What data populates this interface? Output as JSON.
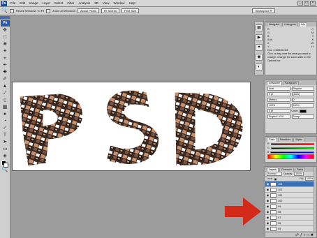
{
  "app": {
    "logo": "Ps"
  },
  "menu": [
    "File",
    "Edit",
    "Image",
    "Layer",
    "Select",
    "Filter",
    "Analysis",
    "3D",
    "View",
    "Window",
    "Help"
  ],
  "window_controls": [
    "_",
    "□",
    "×"
  ],
  "options": {
    "tool_icon": "zoom-icon",
    "resize_label": "Resize Windows To Fit",
    "zoom_all_label": "Zoom All Windows",
    "actual_pixels": "Actual Pixels",
    "fit_screen": "Fit Screen",
    "print_size": "Print Size",
    "workspace": "Workspace ▾"
  },
  "navigator": {
    "tabs": [
      "Navigator",
      "Histogram",
      "Info"
    ],
    "doc_info": "Doc: 4.30M/26.3M",
    "hint": "Click or drag over the area you want to enlarge. Change the zoom state on the Options bar."
  },
  "character": {
    "tabs": [
      "Character",
      "Paragraph"
    ],
    "font": "Arial",
    "style": "Regular",
    "size": "9 pt",
    "leading": "(Auto)",
    "kerning": "Metrics",
    "tracking": "0",
    "scale_v": "100%",
    "scale_h": "100%",
    "baseline": "0 pt",
    "color_label": "Color:",
    "language": "English: USA",
    "aa": "Sharp"
  },
  "color_panel": {
    "tabs": [
      "Color",
      "Swatches",
      "Styles"
    ],
    "sliders": [
      "R",
      "G",
      "B"
    ]
  },
  "layers": {
    "tabs": [
      "Layers",
      "Channels",
      "Paths"
    ],
    "blend": "Normal",
    "opacity_label": "Opacity:",
    "opacity": "100%",
    "lock_label": "Lock:",
    "fill_label": "Fill:",
    "fill": "100%",
    "items": [
      "103",
      "102",
      "101",
      "100",
      "99",
      "98",
      "97",
      "96",
      "95",
      "94"
    ]
  },
  "colors": {
    "accent": "#d42a1a",
    "selection": "#3d6fb3"
  }
}
